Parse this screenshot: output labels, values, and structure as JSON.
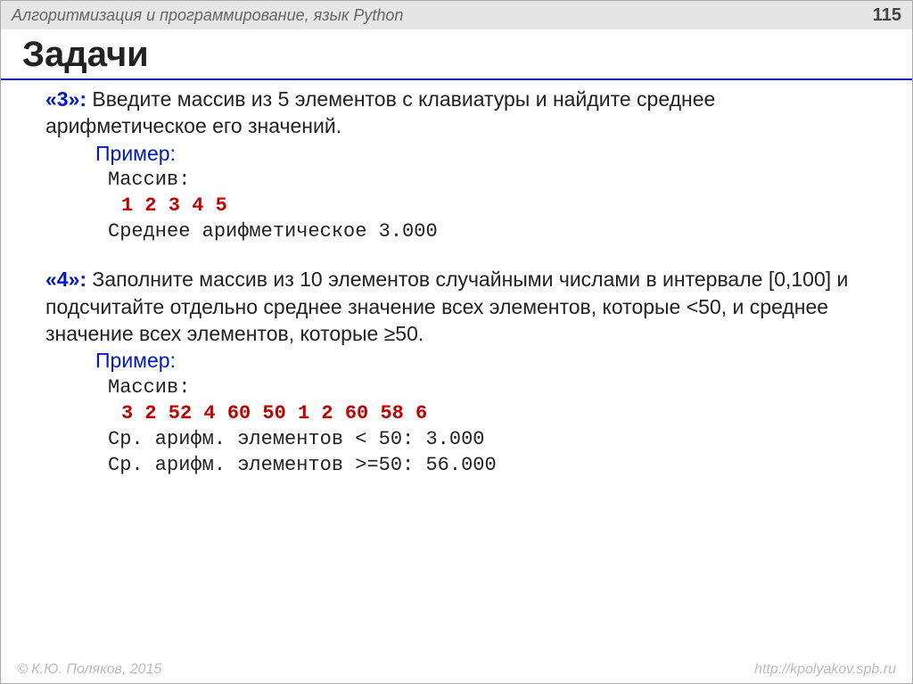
{
  "header": {
    "title": "Алгоритмизация и программирование, язык Python",
    "page": "115"
  },
  "title": "Задачи",
  "task3": {
    "label": "«3»:",
    "text": " Введите массив из 5 элементов с клавиатуры и найдите среднее арифметическое его значений.",
    "example_label": "Пример:",
    "prompt": "Массив:",
    "input": "1 2 3 4 5",
    "result": "Среднее арифметическое 3.000"
  },
  "task4": {
    "label": "«4»:",
    "text": " Заполните массив из 10 элементов случайными числами в интервале [0,100] и подсчитайте отдельно среднее значение всех элементов, которые <50, и среднее значение всех элементов, которые ≥50.",
    "example_label": "Пример:",
    "prompt": "Массив:",
    "input": "3 2 52 4 60 50 1 2 60 58 6",
    "result1": "Ср. арифм. элементов < 50: 3.000",
    "result2": "Ср. арифм. элементов >=50: 56.000"
  },
  "footer": {
    "left": "© К.Ю. Поляков, 2015",
    "right": "http://kpolyakov.spb.ru"
  }
}
